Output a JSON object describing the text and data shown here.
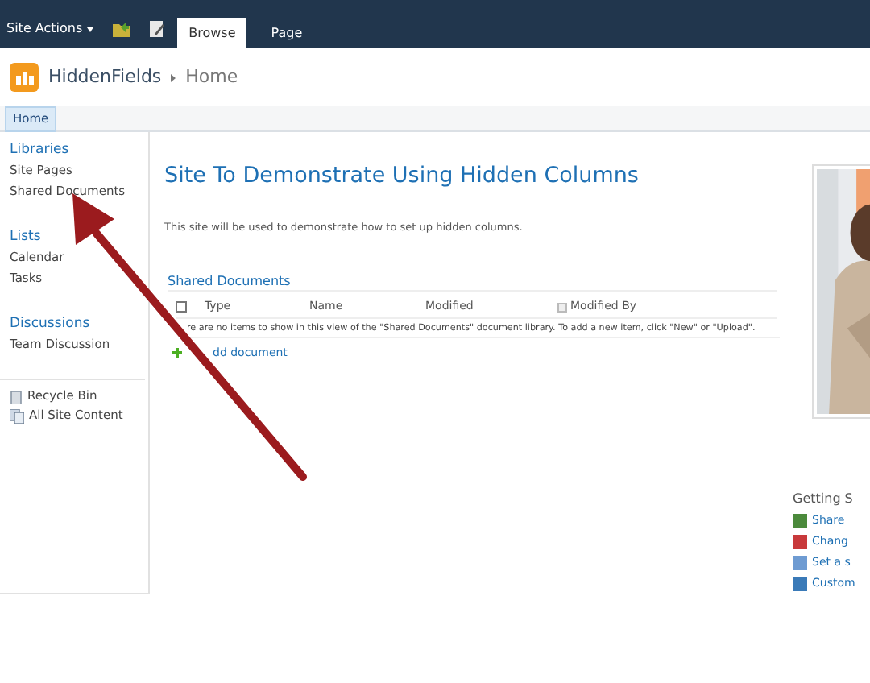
{
  "ribbon": {
    "site_actions": "Site Actions",
    "tabs": [
      {
        "label": "Browse",
        "selected": true
      },
      {
        "label": "Page",
        "selected": false
      }
    ]
  },
  "header": {
    "site": "HiddenFields",
    "page": "Home"
  },
  "top_nav": [
    {
      "label": "Home",
      "selected": true
    }
  ],
  "quick_launch": {
    "sections": [
      {
        "heading": "Libraries",
        "items": [
          "Site Pages",
          "Shared Documents"
        ]
      },
      {
        "heading": "Lists",
        "items": [
          "Calendar",
          "Tasks"
        ]
      },
      {
        "heading": "Discussions",
        "items": [
          "Team Discussion"
        ]
      }
    ],
    "footer": [
      "Recycle Bin",
      "All Site Content"
    ]
  },
  "content": {
    "title": "Site To Demonstrate Using Hidden Columns",
    "description": "This site will be used to demonstrate how to set up hidden columns.",
    "library": {
      "title": "Shared Documents",
      "select_all": {
        "checked": false
      },
      "columns": [
        "Type",
        "Name",
        "Modified",
        "Modified By"
      ],
      "empty_message": "re are no items to show in this view of the \"Shared Documents\" document library. To add a new item, click \"New\" or \"Upload\".",
      "add_link": "dd document"
    }
  },
  "getting_started": {
    "title": "Getting S",
    "links": [
      "Share",
      "Chang",
      "Set a s",
      "Custom"
    ]
  }
}
